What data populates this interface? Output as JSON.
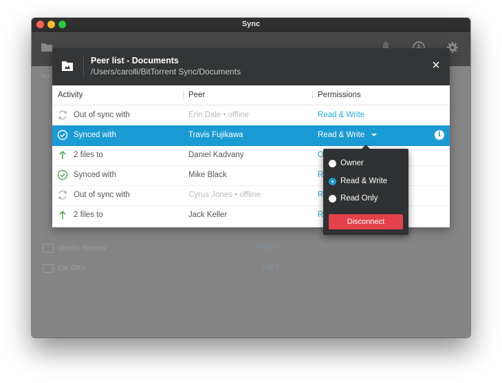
{
  "window": {
    "title": "Sync"
  },
  "background_list": {
    "header_fragment": "Na",
    "rows": [
      {
        "name": "Weekly Reports",
        "count": "3 of 4"
      },
      {
        "name": "Cat GIFs",
        "count": "4 of 4"
      }
    ]
  },
  "dialog": {
    "title": "Peer list - Documents",
    "path": "/Users/carolli/BitTorrent Sync/Documents",
    "close_glyph": "×",
    "columns": {
      "activity": "Activity",
      "peer": "Peer",
      "permissions": "Permissions"
    },
    "rows": [
      {
        "icon": "out-of-sync-icon",
        "activity": "Out of sync with",
        "peer": "Erin Dale • offline",
        "permission": "Read & Write"
      },
      {
        "icon": "synced-icon",
        "activity": "Synced with",
        "peer": "Travis Fujikawa",
        "permission": "Read & Write"
      },
      {
        "icon": "upload-arrow-icon",
        "activity": "2 files to",
        "peer": "Daniel Kadvany",
        "permission": "O"
      },
      {
        "icon": "synced-icon",
        "activity": "Synced with",
        "peer": "Mike Black",
        "permission": "R"
      },
      {
        "icon": "out-of-sync-icon",
        "activity": "Out of sync with",
        "peer": "Cyrus Jones • offline",
        "permission": "R"
      },
      {
        "icon": "upload-arrow-icon",
        "activity": "2 files to",
        "peer": "Jack Keller",
        "permission": "R"
      }
    ],
    "info_glyph": "i"
  },
  "permission_menu": {
    "options": [
      {
        "label": "Owner",
        "selected": false
      },
      {
        "label": "Read & Write",
        "selected": true
      },
      {
        "label": "Read Only",
        "selected": false
      }
    ],
    "disconnect_label": "Disconnect"
  },
  "colors": {
    "accent": "#1b9bd3",
    "link": "#22aee3",
    "danger": "#e5414a",
    "success": "#4caf50"
  }
}
